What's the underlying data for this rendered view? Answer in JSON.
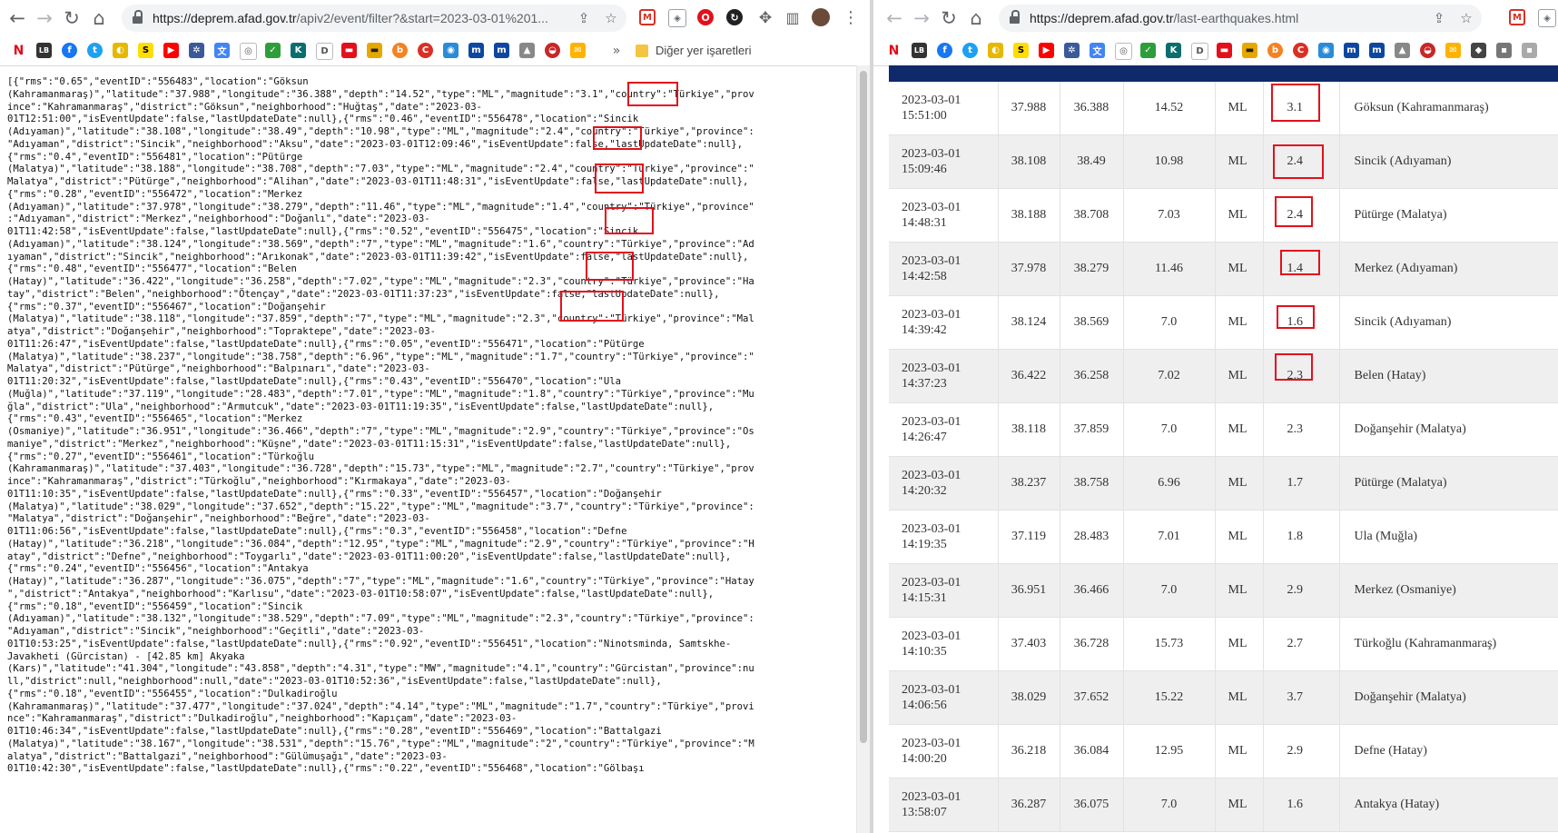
{
  "left_window": {
    "url_host": "https://deprem.afad.gov.tr",
    "url_path": "/apiv2/event/filter?&start=2023-03-01%201...",
    "bookmarks_folder": "Diğer yer işaretleri",
    "json_lines": [
      "[{\"rms\":\"0.65\",\"eventID\":\"556483\",\"location\":\"Göksun",
      "(Kahramanmaraş)\",\"latitude\":\"37.988\",\"longitude\":\"36.388\",\"depth\":\"14.52\",\"type\":\"ML\",\"magnitude\":\"3.1\",\"country\":\"Türkiye\",\"prov",
      "ince\":\"Kahramanmaraş\",\"district\":\"Göksun\",\"neighborhood\":\"Huğtaş\",\"date\":\"2023-03-",
      "01T12:51:00\",\"isEventUpdate\":false,\"lastUpdateDate\":null},{\"rms\":\"0.46\",\"eventID\":\"556478\",\"location\":\"Sincik",
      "(Adıyaman)\",\"latitude\":\"38.108\",\"longitude\":\"38.49\",\"depth\":\"10.98\",\"type\":\"ML\",\"magnitude\":\"2.4\",\"country\":\"Türkiye\",\"province\":",
      "\"Adıyaman\",\"district\":\"Sincik\",\"neighborhood\":\"Aksu\",\"date\":\"2023-03-01T12:09:46\",\"isEventUpdate\":false,\"lastUpdateDate\":null},",
      "{\"rms\":\"0.4\",\"eventID\":\"556481\",\"location\":\"Pütürge",
      "(Malatya)\",\"latitude\":\"38.188\",\"longitude\":\"38.708\",\"depth\":\"7.03\",\"type\":\"ML\",\"magnitude\":\"2.4\",\"country\":\"Türkiye\",\"province\":\"",
      "Malatya\",\"district\":\"Pütürge\",\"neighborhood\":\"Alihan\",\"date\":\"2023-03-01T11:48:31\",\"isEventUpdate\":false,\"lastUpdateDate\":null},",
      "{\"rms\":\"0.28\",\"eventID\":\"556472\",\"location\":\"Merkez",
      "(Adıyaman)\",\"latitude\":\"37.978\",\"longitude\":\"38.279\",\"depth\":\"11.46\",\"type\":\"ML\",\"magnitude\":\"1.4\",\"country\":\"Türkiye\",\"province\"",
      ":\"Adıyaman\",\"district\":\"Merkez\",\"neighborhood\":\"Doğanlı\",\"date\":\"2023-03-",
      "01T11:42:58\",\"isEventUpdate\":false,\"lastUpdateDate\":null},{\"rms\":\"0.52\",\"eventID\":\"556475\",\"location\":\"Sincik",
      "(Adıyaman)\",\"latitude\":\"38.124\",\"longitude\":\"38.569\",\"depth\":\"7\",\"type\":\"ML\",\"magnitude\":\"1.6\",\"country\":\"Türkiye\",\"province\":\"Ad",
      "ıyaman\",\"district\":\"Sincik\",\"neighborhood\":\"Arıkonak\",\"date\":\"2023-03-01T11:39:42\",\"isEventUpdate\":false,\"lastUpdateDate\":null},",
      "{\"rms\":\"0.48\",\"eventID\":\"556477\",\"location\":\"Belen",
      "(Hatay)\",\"latitude\":\"36.422\",\"longitude\":\"36.258\",\"depth\":\"7.02\",\"type\":\"ML\",\"magnitude\":\"2.3\",\"country\":\"Türkiye\",\"province\":\"Ha",
      "tay\",\"district\":\"Belen\",\"neighborhood\":\"Ötençay\",\"date\":\"2023-03-01T11:37:23\",\"isEventUpdate\":false,\"lastUpdateDate\":null},",
      "{\"rms\":\"0.37\",\"eventID\":\"556467\",\"location\":\"Doğanşehir",
      "(Malatya)\",\"latitude\":\"38.118\",\"longitude\":\"37.859\",\"depth\":\"7\",\"type\":\"ML\",\"magnitude\":\"2.3\",\"country\":\"Türkiye\",\"province\":\"Mal",
      "atya\",\"district\":\"Doğanşehir\",\"neighborhood\":\"Topraktepe\",\"date\":\"2023-03-",
      "01T11:26:47\",\"isEventUpdate\":false,\"lastUpdateDate\":null},{\"rms\":\"0.05\",\"eventID\":\"556471\",\"location\":\"Pütürge",
      "(Malatya)\",\"latitude\":\"38.237\",\"longitude\":\"38.758\",\"depth\":\"6.96\",\"type\":\"ML\",\"magnitude\":\"1.7\",\"country\":\"Türkiye\",\"province\":\"",
      "Malatya\",\"district\":\"Pütürge\",\"neighborhood\":\"Balpınarı\",\"date\":\"2023-03-",
      "01T11:20:32\",\"isEventUpdate\":false,\"lastUpdateDate\":null},{\"rms\":\"0.43\",\"eventID\":\"556470\",\"location\":\"Ula",
      "(Muğla)\",\"latitude\":\"37.119\",\"longitude\":\"28.483\",\"depth\":\"7.01\",\"type\":\"ML\",\"magnitude\":\"1.8\",\"country\":\"Türkiye\",\"province\":\"Mu",
      "ğla\",\"district\":\"Ula\",\"neighborhood\":\"Armutcuk\",\"date\":\"2023-03-01T11:19:35\",\"isEventUpdate\":false,\"lastUpdateDate\":null},",
      "{\"rms\":\"0.43\",\"eventID\":\"556465\",\"location\":\"Merkez",
      "(Osmaniye)\",\"latitude\":\"36.951\",\"longitude\":\"36.466\",\"depth\":\"7\",\"type\":\"ML\",\"magnitude\":\"2.9\",\"country\":\"Türkiye\",\"province\":\"Os",
      "maniye\",\"district\":\"Merkez\",\"neighborhood\":\"Küşne\",\"date\":\"2023-03-01T11:15:31\",\"isEventUpdate\":false,\"lastUpdateDate\":null},",
      "{\"rms\":\"0.27\",\"eventID\":\"556461\",\"location\":\"Türkoğlu",
      "(Kahramanmaraş)\",\"latitude\":\"37.403\",\"longitude\":\"36.728\",\"depth\":\"15.73\",\"type\":\"ML\",\"magnitude\":\"2.7\",\"country\":\"Türkiye\",\"prov",
      "ince\":\"Kahramanmaraş\",\"district\":\"Türkoğlu\",\"neighborhood\":\"Kırmakaya\",\"date\":\"2023-03-",
      "01T11:10:35\",\"isEventUpdate\":false,\"lastUpdateDate\":null},{\"rms\":\"0.33\",\"eventID\":\"556457\",\"location\":\"Doğanşehir",
      "(Malatya)\",\"latitude\":\"38.029\",\"longitude\":\"37.652\",\"depth\":\"15.22\",\"type\":\"ML\",\"magnitude\":\"3.7\",\"country\":\"Türkiye\",\"province\":",
      "\"Malatya\",\"district\":\"Doğanşehir\",\"neighborhood\":\"Beğre\",\"date\":\"2023-03-",
      "01T11:06:56\",\"isEventUpdate\":false,\"lastUpdateDate\":null},{\"rms\":\"0.3\",\"eventID\":\"556458\",\"location\":\"Defne",
      "(Hatay)\",\"latitude\":\"36.218\",\"longitude\":\"36.084\",\"depth\":\"12.95\",\"type\":\"ML\",\"magnitude\":\"2.9\",\"country\":\"Türkiye\",\"province\":\"H",
      "atay\",\"district\":\"Defne\",\"neighborhood\":\"Toygarlı\",\"date\":\"2023-03-01T11:00:20\",\"isEventUpdate\":false,\"lastUpdateDate\":null},",
      "{\"rms\":\"0.24\",\"eventID\":\"556456\",\"location\":\"Antakya",
      "(Hatay)\",\"latitude\":\"36.287\",\"longitude\":\"36.075\",\"depth\":\"7\",\"type\":\"ML\",\"magnitude\":\"1.6\",\"country\":\"Türkiye\",\"province\":\"Hatay",
      "\",\"district\":\"Antakya\",\"neighborhood\":\"Karlısu\",\"date\":\"2023-03-01T10:58:07\",\"isEventUpdate\":false,\"lastUpdateDate\":null},",
      "{\"rms\":\"0.18\",\"eventID\":\"556459\",\"location\":\"Sincik",
      "(Adıyaman)\",\"latitude\":\"38.132\",\"longitude\":\"38.529\",\"depth\":\"7.09\",\"type\":\"ML\",\"magnitude\":\"2.3\",\"country\":\"Türkiye\",\"province\":",
      "\"Adıyaman\",\"district\":\"Sincik\",\"neighborhood\":\"Geçitli\",\"date\":\"2023-03-",
      "01T10:53:25\",\"isEventUpdate\":false,\"lastUpdateDate\":null},{\"rms\":\"0.92\",\"eventID\":\"556451\",\"location\":\"Ninotsminda, Samtskhe-",
      "Javakheti (Gürcistan) - [42.85 km] Akyaka",
      "(Kars)\",\"latitude\":\"41.304\",\"longitude\":\"43.858\",\"depth\":\"4.31\",\"type\":\"MW\",\"magnitude\":\"4.1\",\"country\":\"Gürcistan\",\"province\":nu",
      "ll,\"district\":null,\"neighborhood\":null,\"date\":\"2023-03-01T10:52:36\",\"isEventUpdate\":false,\"lastUpdateDate\":null},",
      "{\"rms\":\"0.18\",\"eventID\":\"556455\",\"location\":\"Dulkadiroğlu",
      "(Kahramanmaraş)\",\"latitude\":\"37.477\",\"longitude\":\"37.024\",\"depth\":\"4.14\",\"type\":\"ML\",\"magnitude\":\"1.7\",\"country\":\"Türkiye\",\"provi",
      "nce\":\"Kahramanmaraş\",\"district\":\"Dulkadiroğlu\",\"neighborhood\":\"Kapıçam\",\"date\":\"2023-03-",
      "01T10:46:34\",\"isEventUpdate\":false,\"lastUpdateDate\":null},{\"rms\":\"0.28\",\"eventID\":\"556469\",\"location\":\"Battalgazi",
      "(Malatya)\",\"latitude\":\"38.167\",\"longitude\":\"38.531\",\"depth\":\"15.76\",\"type\":\"ML\",\"magnitude\":\"2\",\"country\":\"Türkiye\",\"province\":\"M",
      "alatya\",\"district\":\"Battalgazi\",\"neighborhood\":\"Gülümuşağı\",\"date\":\"2023-03-",
      "01T10:42:30\",\"isEventUpdate\":false,\"lastUpdateDate\":null},{\"rms\":\"0.22\",\"eventID\":\"556468\",\"location\":\"Gölbaşı"
    ]
  },
  "right_window": {
    "url_host": "https://deprem.afad.gov.tr",
    "url_path": "/last-earthquakes.html",
    "rows": [
      {
        "date": "2023-03-01",
        "time": "15:51:00",
        "lat": "37.988",
        "lon": "36.388",
        "depth": "14.52",
        "type": "ML",
        "mag": "3.1",
        "location": "Göksun (Kahramanmaraş)",
        "highlight": true
      },
      {
        "date": "2023-03-01",
        "time": "15:09:46",
        "lat": "38.108",
        "lon": "38.49",
        "depth": "10.98",
        "type": "ML",
        "mag": "2.4",
        "location": "Sincik (Adıyaman)",
        "highlight": true
      },
      {
        "date": "2023-03-01",
        "time": "14:48:31",
        "lat": "38.188",
        "lon": "38.708",
        "depth": "7.03",
        "type": "ML",
        "mag": "2.4",
        "location": "Pütürge (Malatya)",
        "highlight": true
      },
      {
        "date": "2023-03-01",
        "time": "14:42:58",
        "lat": "37.978",
        "lon": "38.279",
        "depth": "11.46",
        "type": "ML",
        "mag": "1.4",
        "location": "Merkez (Adıyaman)",
        "highlight": true
      },
      {
        "date": "2023-03-01",
        "time": "14:39:42",
        "lat": "38.124",
        "lon": "38.569",
        "depth": "7.0",
        "type": "ML",
        "mag": "1.6",
        "location": "Sincik (Adıyaman)",
        "highlight": true
      },
      {
        "date": "2023-03-01",
        "time": "14:37:23",
        "lat": "36.422",
        "lon": "36.258",
        "depth": "7.02",
        "type": "ML",
        "mag": "2.3",
        "location": "Belen (Hatay)",
        "highlight": true
      },
      {
        "date": "2023-03-01",
        "time": "14:26:47",
        "lat": "38.118",
        "lon": "37.859",
        "depth": "7.0",
        "type": "ML",
        "mag": "2.3",
        "location": "Doğanşehir (Malatya)",
        "highlight": false
      },
      {
        "date": "2023-03-01",
        "time": "14:20:32",
        "lat": "38.237",
        "lon": "38.758",
        "depth": "6.96",
        "type": "ML",
        "mag": "1.7",
        "location": "Pütürge (Malatya)",
        "highlight": false
      },
      {
        "date": "2023-03-01",
        "time": "14:19:35",
        "lat": "37.119",
        "lon": "28.483",
        "depth": "7.01",
        "type": "ML",
        "mag": "1.8",
        "location": "Ula (Muğla)",
        "highlight": false
      },
      {
        "date": "2023-03-01",
        "time": "14:15:31",
        "lat": "36.951",
        "lon": "36.466",
        "depth": "7.0",
        "type": "ML",
        "mag": "2.9",
        "location": "Merkez (Osmaniye)",
        "highlight": false
      },
      {
        "date": "2023-03-01",
        "time": "14:10:35",
        "lat": "37.403",
        "lon": "36.728",
        "depth": "15.73",
        "type": "ML",
        "mag": "2.7",
        "location": "Türkoğlu (Kahramanmaraş)",
        "highlight": false
      },
      {
        "date": "2023-03-01",
        "time": "14:06:56",
        "lat": "38.029",
        "lon": "37.652",
        "depth": "15.22",
        "type": "ML",
        "mag": "3.7",
        "location": "Doğanşehir (Malatya)",
        "highlight": false
      },
      {
        "date": "2023-03-01",
        "time": "14:00:20",
        "lat": "36.218",
        "lon": "36.084",
        "depth": "12.95",
        "type": "ML",
        "mag": "2.9",
        "location": "Defne (Hatay)",
        "highlight": false
      },
      {
        "date": "2023-03-01",
        "time": "13:58:07",
        "lat": "36.287",
        "lon": "36.075",
        "depth": "7.0",
        "type": "ML",
        "mag": "1.6",
        "location": "Antakya (Hatay)",
        "highlight": false
      }
    ]
  },
  "icons": {
    "back": "arrow-left-icon",
    "forward": "arrow-right-icon",
    "reload": "reload-icon",
    "home": "home-icon",
    "lock": "lock-icon",
    "share": "share-icon",
    "star": "star-icon",
    "extensions": "puzzle-icon",
    "sidepanel": "side-panel-icon",
    "menu": "kebab-menu-icon",
    "folder": "folder-icon"
  },
  "colors": {
    "highlight_box": "#e3101b",
    "site_header": "#0f2a6b",
    "row_alt": "#efefef"
  }
}
